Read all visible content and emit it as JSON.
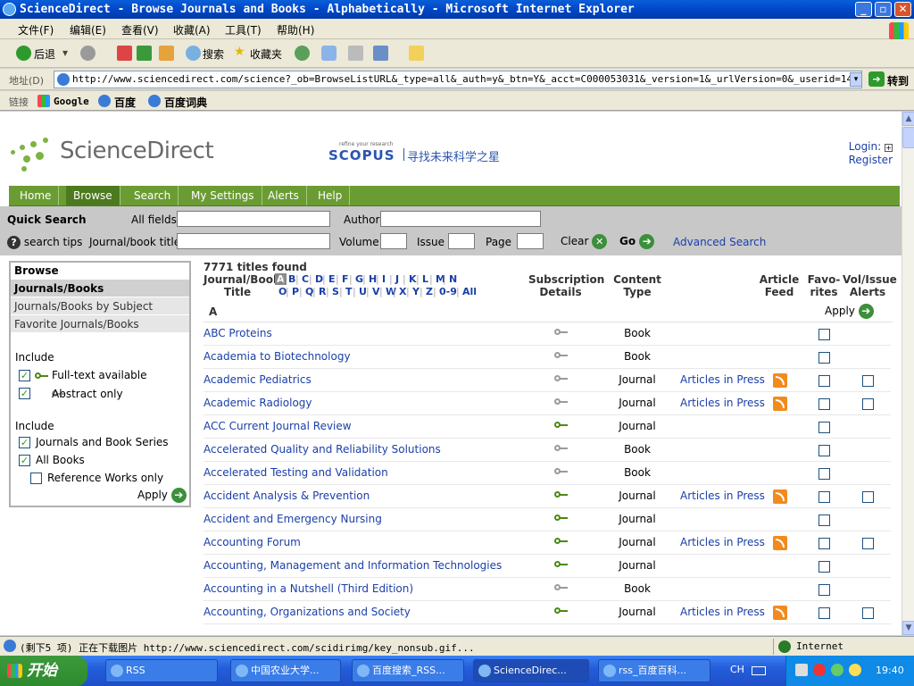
{
  "window": {
    "title": "ScienceDirect - Browse Journals and Books - Alphabetically - Microsoft Internet Explorer"
  },
  "menu": [
    "文件(F)",
    "编辑(E)",
    "查看(V)",
    "收藏(A)",
    "工具(T)",
    "帮助(H)"
  ],
  "toolbar": {
    "back": "后退",
    "search": "搜索",
    "favorites": "收藏夹"
  },
  "address": {
    "label": "地址(D)",
    "url": "http://www.sciencedirect.com/science?_ob=BrowseListURL&_type=all&_auth=y&_btn=Y&_acct=C000053031&_version=1&_urlVersion=0&_userid=1479053&md5=b3",
    "go": "转到"
  },
  "links": {
    "label": "链接",
    "items": [
      "Google",
      "百度",
      "百度词典"
    ]
  },
  "site": {
    "logo": "ScienceDirect",
    "scopus_tag": "refine your research",
    "scopus_brand": "SCOPUS",
    "scopus_tagline": "寻找未来科学之星",
    "login": "Login:",
    "register": "Register"
  },
  "nav": [
    "Home",
    "Browse",
    "Search",
    "My Settings",
    "Alerts",
    "Help"
  ],
  "quick_search": {
    "title": "Quick Search",
    "all_fields": "All fields",
    "author": "Author",
    "search_tips": "search tips",
    "journal_title": "Journal/book title",
    "volume": "Volume",
    "issue": "Issue",
    "page": "Page",
    "clear": "Clear",
    "go": "Go",
    "advanced": "Advanced Search"
  },
  "browse": {
    "heading": "Browse",
    "options": [
      "Journals/Books Alphabetically",
      "Journals/Books by Subject",
      "Favorite Journals/Books"
    ],
    "include1_label": "Include",
    "fulltext": "Full-text available",
    "abstract": "Abstract only",
    "include2_label": "Include",
    "journals_series": "Journals and Book Series",
    "all_books": "All Books",
    "reference_works": "Reference Works only",
    "apply": "Apply"
  },
  "results": {
    "count": "7771 titles found",
    "col_title": "Journal/Book",
    "col_title2": "Title",
    "letters_row1": [
      "A",
      "B",
      "C",
      "D",
      "E",
      "F",
      "G",
      "H",
      "I",
      "J",
      "K",
      "L",
      "M",
      "N"
    ],
    "letters_row2": [
      "O",
      "P",
      "Q",
      "R",
      "S",
      "T",
      "U",
      "V",
      "W",
      "X",
      "Y",
      "Z",
      "0-9",
      "All"
    ],
    "col_sub": "Subscription",
    "col_sub2": "Details",
    "col_content": "Content",
    "col_content2": "Type",
    "col_feed": "Article",
    "col_feed2": "Feed",
    "col_fav": "Favo-",
    "col_fav2": "rites",
    "col_alerts": "Vol/Issue",
    "col_alerts2": "Alerts",
    "section": "A",
    "apply": "Apply",
    "rows": [
      {
        "title": "ABC Proteins",
        "access": "abstract",
        "type": "Book",
        "press": "",
        "alert": false
      },
      {
        "title": "Academia to Biotechnology",
        "access": "abstract",
        "type": "Book",
        "press": "",
        "alert": false
      },
      {
        "title": "Academic Pediatrics",
        "access": "abstract",
        "type": "Journal",
        "press": "Articles in Press",
        "alert": true
      },
      {
        "title": "Academic Radiology",
        "access": "abstract",
        "type": "Journal",
        "press": "Articles in Press",
        "alert": true
      },
      {
        "title": "ACC Current Journal Review",
        "access": "full",
        "type": "Journal",
        "press": "",
        "alert": false
      },
      {
        "title": "Accelerated Quality and Reliability Solutions",
        "access": "abstract",
        "type": "Book",
        "press": "",
        "alert": false
      },
      {
        "title": "Accelerated Testing and Validation",
        "access": "abstract",
        "type": "Book",
        "press": "",
        "alert": false
      },
      {
        "title": "Accident Analysis & Prevention",
        "access": "full",
        "type": "Journal",
        "press": "Articles in Press",
        "alert": true
      },
      {
        "title": "Accident and Emergency Nursing",
        "access": "full",
        "type": "Journal",
        "press": "",
        "alert": false
      },
      {
        "title": "Accounting Forum",
        "access": "full",
        "type": "Journal",
        "press": "Articles in Press",
        "alert": true
      },
      {
        "title": "Accounting, Management and Information Technologies",
        "access": "full",
        "type": "Journal",
        "press": "",
        "alert": false
      },
      {
        "title": "Accounting in a Nutshell (Third Edition)",
        "access": "abstract",
        "type": "Book",
        "press": "",
        "alert": false
      },
      {
        "title": "Accounting, Organizations and Society",
        "access": "full",
        "type": "Journal",
        "press": "Articles in Press",
        "alert": true
      }
    ]
  },
  "status": {
    "text": "(剩下5 项) 正在下载图片 http://www.sciencedirect.com/scidirimg/key_nonsub.gif...",
    "zone": "Internet"
  },
  "taskbar": {
    "start": "开始",
    "tasks": [
      "RSS",
      "中国农业大学...",
      "百度搜索_RSS...",
      "ScienceDirec...",
      "rss_百度百科..."
    ],
    "lang": "CH",
    "clock": "19:40"
  }
}
